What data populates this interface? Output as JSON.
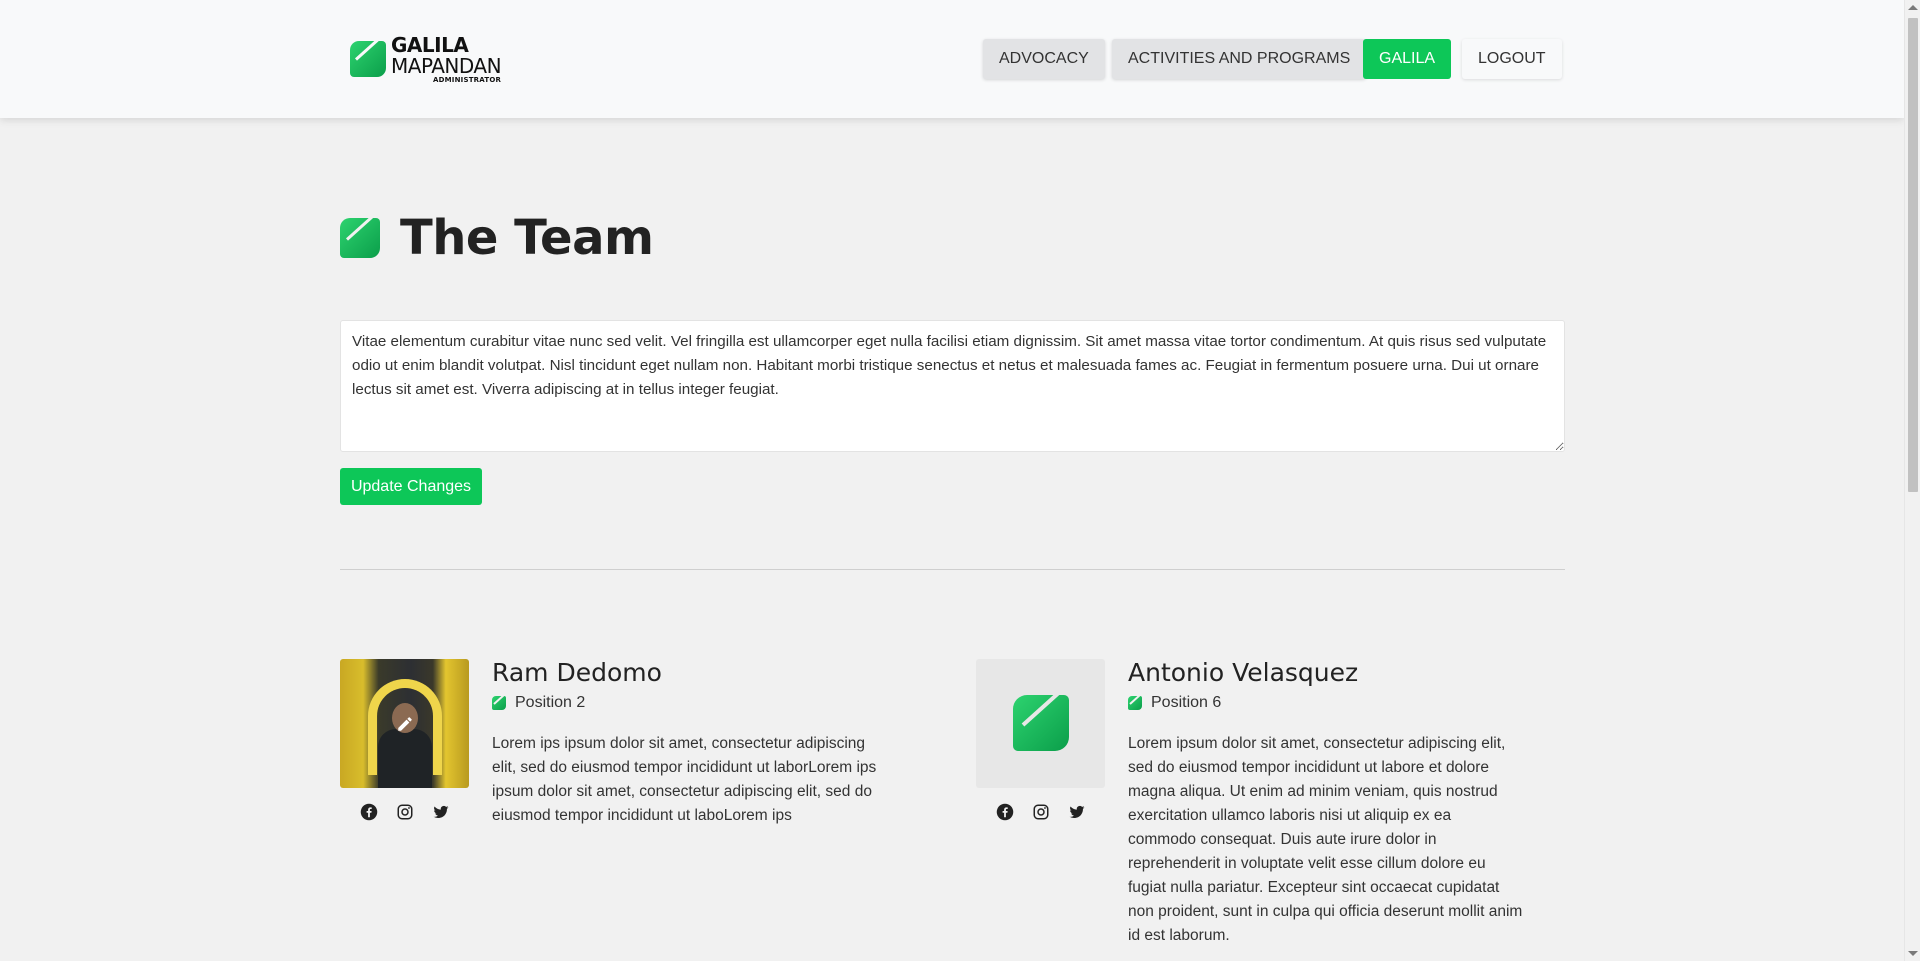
{
  "brand": {
    "line1": "GALILA",
    "line2": "MAPANDAN",
    "line3": "ADMINISTRATOR"
  },
  "nav": {
    "items": [
      {
        "label": "ADVOCACY"
      },
      {
        "label": "ACTIVITIES AND PROGRAMS"
      },
      {
        "label": "GALILA"
      },
      {
        "label": "LOGOUT"
      }
    ]
  },
  "page": {
    "title": "The Team",
    "description": "Vitae elementum curabitur vitae nunc sed velit. Vel fringilla est ullamcorper eget nulla facilisi etiam dignissim. Sit amet massa vitae tortor condimentum. At quis risus sed vulputate odio ut enim blandit volutpat. Nisl tincidunt eget nullam non. Habitant morbi tristique senectus et netus et malesuada fames ac. Feugiat in fermentum posuere urna. Dui ut ornare lectus sit amet est. Viverra adipiscing at in tellus integer feugiat.",
    "update_label": "Update Changes"
  },
  "members": [
    {
      "name": "Ram Dedomo",
      "position": "Position 2",
      "bio": "Lorem ips ipsum dolor sit amet, consectetur adipiscing elit, sed do eiusmod tempor incididunt ut laborLorem ips ipsum dolor sit amet, consectetur adipiscing elit, sed do eiusmod tempor incididunt ut laboLorem ips"
    },
    {
      "name": "Antonio Velasquez",
      "position": "Position 6",
      "bio": "Lorem ipsum dolor sit amet, consectetur adipiscing elit, sed do eiusmod tempor incididunt ut labore et dolore magna aliqua. Ut enim ad minim veniam, quis nostrud exercitation ullamco laboris nisi ut aliquip ex ea commodo consequat. Duis aute irure dolor in reprehenderit in voluptate velit esse cillum dolore eu fugiat nulla pariatur. Excepteur sint occaecat cupidatat non proident, sunt in culpa qui officia deserunt mollit anim id est laborum."
    }
  ],
  "colors": {
    "accent": "#0dc758",
    "nav_inactive": "#e2e3e5",
    "background": "#f1f1f1"
  },
  "icons": [
    "leaf-logo-icon",
    "edit-pencil-icon",
    "facebook-icon",
    "instagram-icon",
    "twitter-icon"
  ]
}
